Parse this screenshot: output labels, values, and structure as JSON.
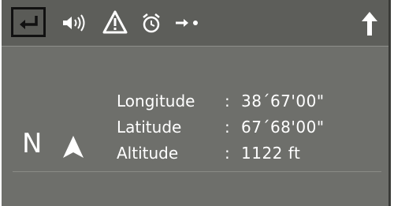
{
  "toolbar": {
    "back_icon": "back-return-icon",
    "speaker_icon": "speaker-sound-icon",
    "warning_icon": "warning-triangle-icon",
    "alarm_icon": "alarm-clock-icon",
    "arrow_dot_icon": "arrow-right-dot-icon",
    "up_icon": "up-arrow-icon"
  },
  "compass": {
    "heading_letter": "N",
    "arrow_icon": "north-arrow-icon"
  },
  "position": {
    "rows": [
      {
        "label": "Longitude",
        "separator": ":",
        "value": "38´67'00\""
      },
      {
        "label": "Latitude",
        "separator": ":",
        "value": "67´68'00\""
      },
      {
        "label": "Altitude",
        "separator": ":",
        "value": "1122 ft"
      }
    ]
  },
  "colors": {
    "background": "#6e6f6b",
    "toolbar": "#5d5e5a",
    "text": "#ffffff"
  }
}
